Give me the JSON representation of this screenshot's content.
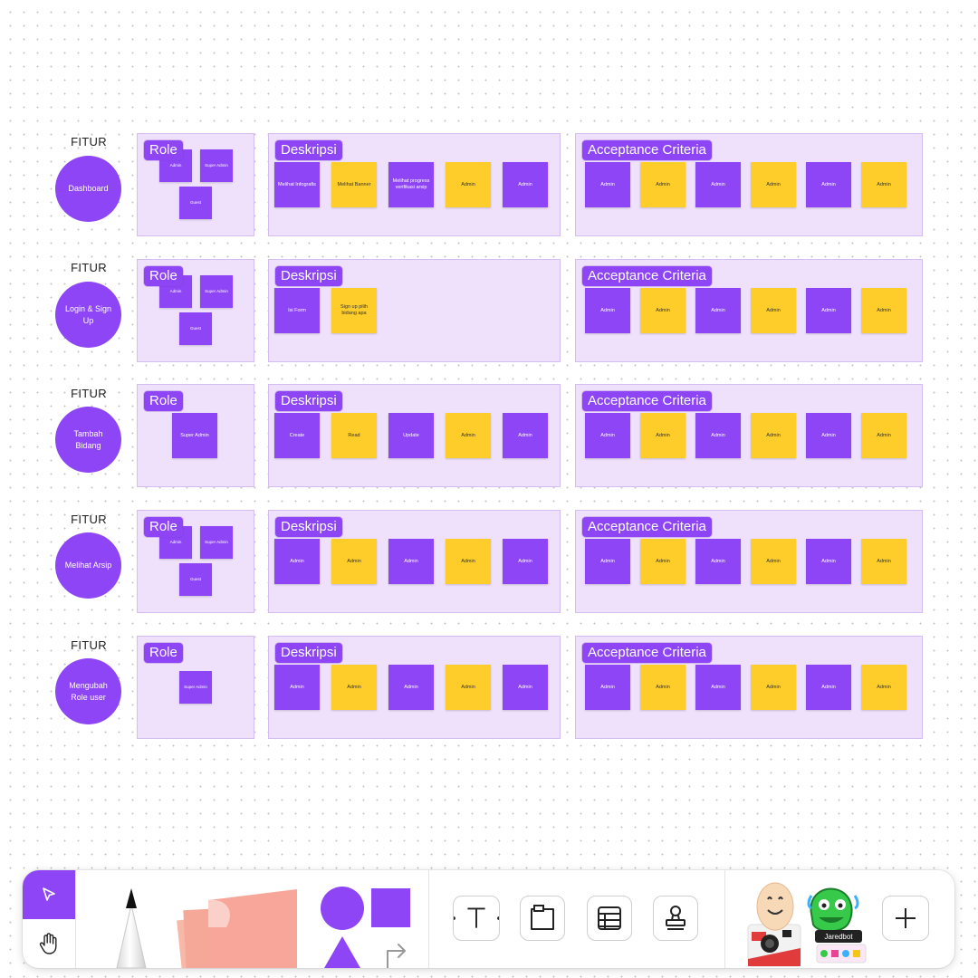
{
  "colors": {
    "accent": "#8e45f5",
    "sticky_yellow": "#ffcd29",
    "section_bg": "#efe1fb"
  },
  "rows": [
    {
      "fitur_label": "FITUR",
      "feature_name": "Dashboard",
      "role_title": "Role",
      "role_notes": [
        "Admin",
        "Super Admin",
        "Guest"
      ],
      "desc_title": "Deskripsi",
      "desc_notes": [
        "Melihat Infografis",
        "Melihat Banner",
        "Melihat progress verifikasi arsip",
        "Admin",
        "Admin"
      ],
      "ac_title": "Acceptance Criteria",
      "ac_notes": [
        "Admin",
        "Admin",
        "Admin",
        "Admin",
        "Admin",
        "Admin"
      ]
    },
    {
      "fitur_label": "FITUR",
      "feature_name": "Login & Sign Up",
      "role_title": "Role",
      "role_notes": [
        "Admin",
        "Super Admin",
        "Guest"
      ],
      "desc_title": "Deskripsi",
      "desc_notes": [
        "Isi Form",
        "Sign up pilih bidang apa"
      ],
      "ac_title": "Acceptance Criteria",
      "ac_notes": [
        "Admin",
        "Admin",
        "Admin",
        "Admin",
        "Admin",
        "Admin"
      ]
    },
    {
      "fitur_label": "FITUR",
      "feature_name": "Tambah Bidang",
      "role_title": "Role",
      "role_notes": [
        "Super Admin"
      ],
      "desc_title": "Deskripsi",
      "desc_notes": [
        "Create",
        "Read",
        "Update",
        "Admin",
        "Admin"
      ],
      "ac_title": "Acceptance Criteria",
      "ac_notes": [
        "Admin",
        "Admin",
        "Admin",
        "Admin",
        "Admin",
        "Admin"
      ]
    },
    {
      "fitur_label": "FITUR",
      "feature_name": "Melihat Arsip",
      "role_title": "Role",
      "role_notes": [
        "Admin",
        "Super Admin",
        "Guest"
      ],
      "desc_title": "Deskripsi",
      "desc_notes": [
        "Admin",
        "Admin",
        "Admin",
        "Admin",
        "Admin"
      ],
      "ac_title": "Acceptance Criteria",
      "ac_notes": [
        "Admin",
        "Admin",
        "Admin",
        "Admin",
        "Admin",
        "Admin"
      ]
    },
    {
      "fitur_label": "FITUR",
      "feature_name": "Mengubah Role user",
      "role_title": "Role",
      "role_notes": [
        "Super Admin"
      ],
      "desc_title": "Deskripsi",
      "desc_notes": [
        "Admin",
        "Admin",
        "Admin",
        "Admin",
        "Admin"
      ],
      "ac_title": "Acceptance Criteria",
      "ac_notes": [
        "Admin",
        "Admin",
        "Admin",
        "Admin",
        "Admin",
        "Admin"
      ]
    }
  ],
  "toolbar": {
    "modes": [
      {
        "icon": "cursor-icon",
        "active": true
      },
      {
        "icon": "hand-icon",
        "active": false
      }
    ],
    "tools": [
      "pen-tool",
      "sticky-note-tool",
      "shapes-tool",
      "text-tool",
      "section-tool",
      "table-tool",
      "stamp-tool",
      "stickers-tool",
      "more-tools"
    ],
    "sticker_label": "Jaredbot"
  }
}
